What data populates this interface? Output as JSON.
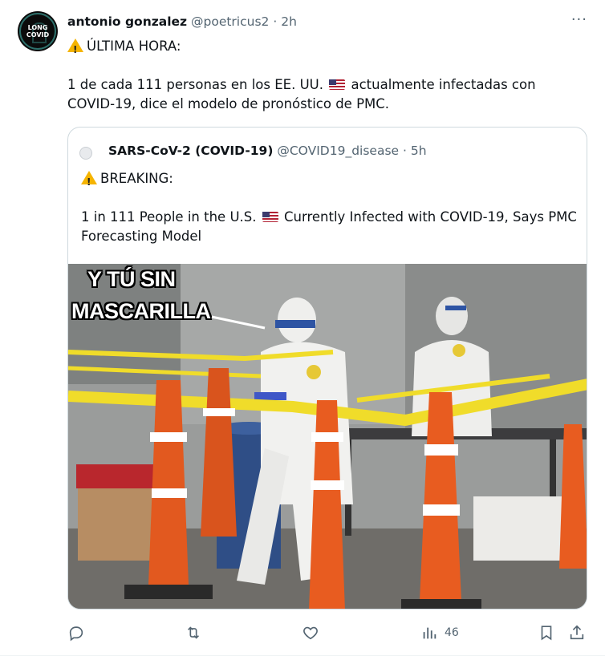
{
  "tweet": {
    "avatar_line1": "LONG",
    "avatar_line2": "COVID",
    "author_name": "antonio gonzalez",
    "handle": "@poetricus2",
    "dot": "·",
    "time": "2h",
    "more": "···",
    "line1": "ÚLTIMA HORA:",
    "line2a": "1 de cada 111 personas en los EE. UU.",
    "line2b": "actualmente infectadas con COVID-19, dice el modelo de pronóstico de PMC.",
    "icons": {
      "warning": "warning-icon",
      "flag": "us-flag-icon"
    }
  },
  "quote": {
    "author_name": "SARS-CoV-2 (COVID-19)",
    "handle": "@COVID19_disease",
    "dot": "·",
    "time": "5h",
    "line1": "BREAKING:",
    "line2a": "1 in 111 People in the U.S.",
    "line2b": "Currently Infected with COVID-19, Says PMC Forecasting Model",
    "image": {
      "caption_line1": "Y TÚ SIN",
      "caption_line2": "MASCARILLA"
    }
  },
  "actions": {
    "reply_icon": "reply-icon",
    "retweet_icon": "retweet-icon",
    "like_icon": "like-icon",
    "views_icon": "views-icon",
    "views_count": "46",
    "bookmark_icon": "bookmark-icon",
    "share_icon": "share-icon"
  },
  "colors": {
    "text": "#0f1419",
    "muted": "#536471",
    "border": "#cfd9de",
    "warning": "#f5b400"
  }
}
